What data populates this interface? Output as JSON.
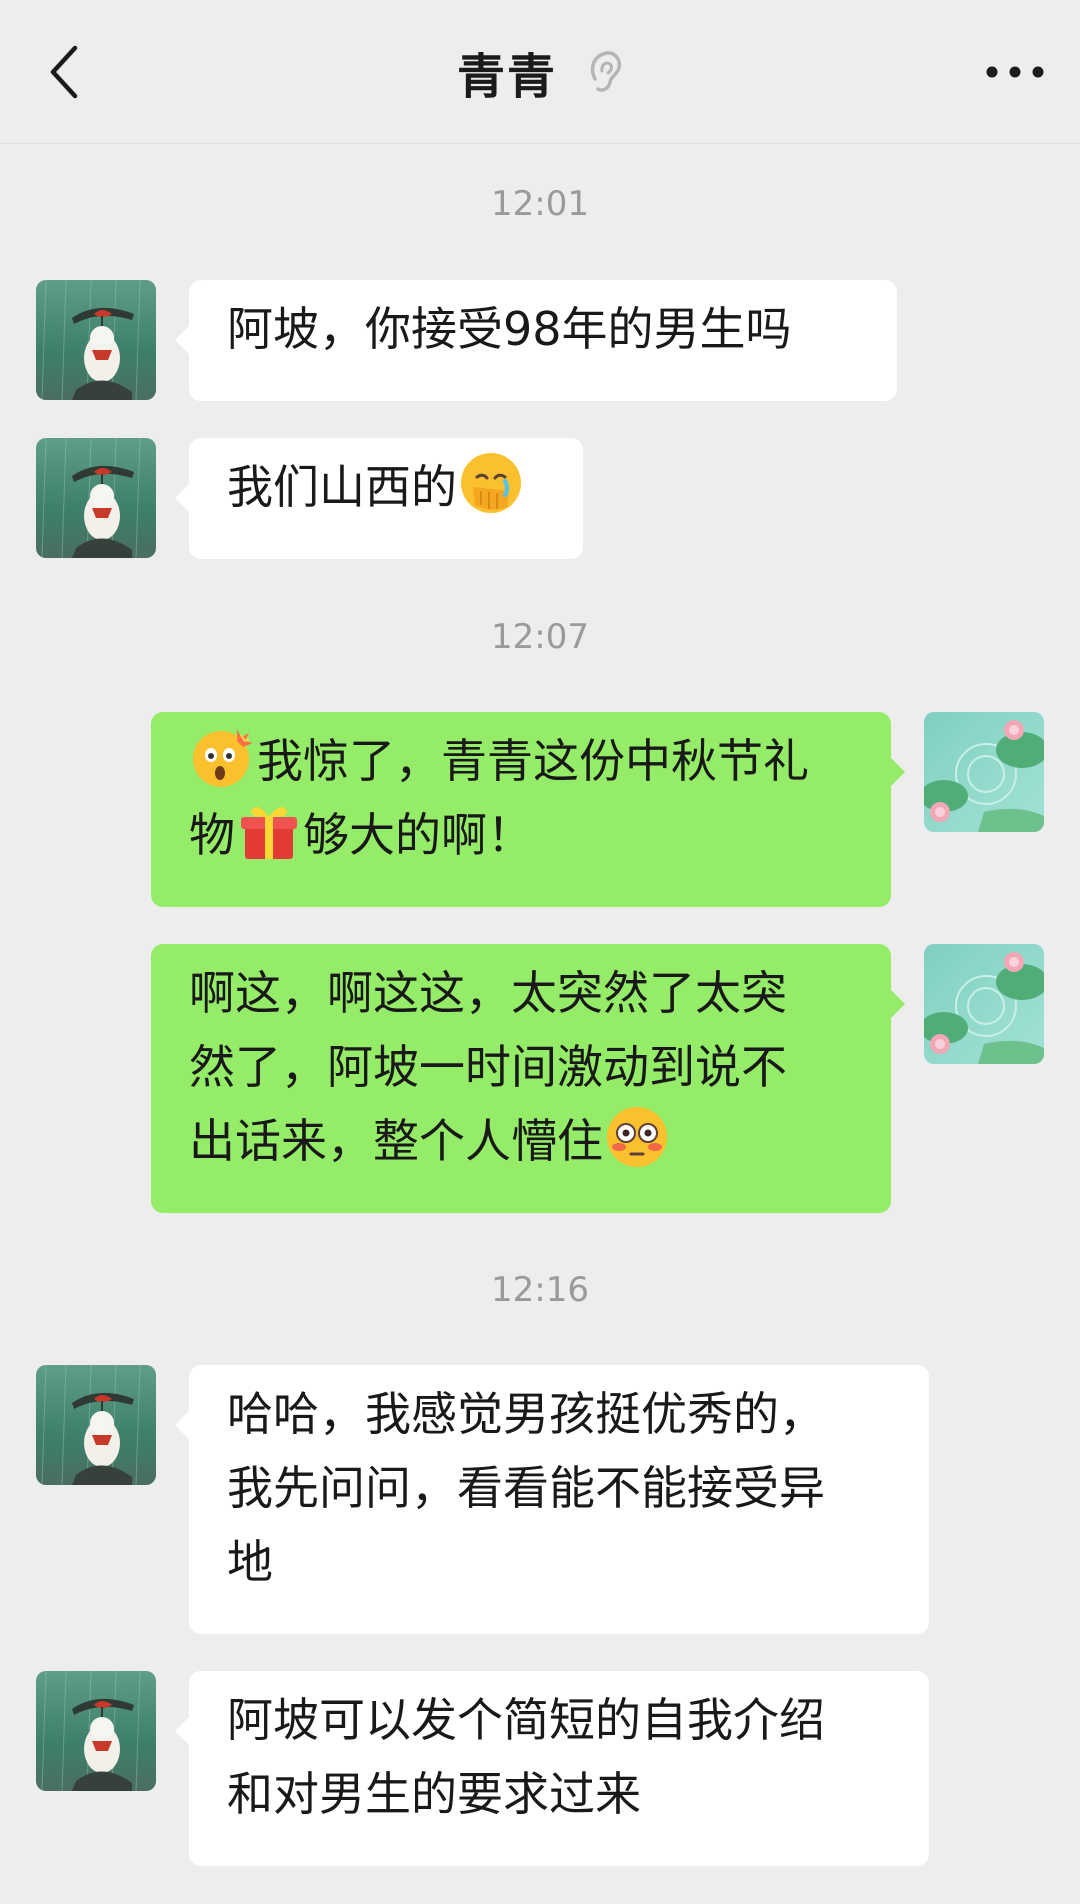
{
  "header": {
    "title": "青青",
    "back_icon": "chevron-left-icon",
    "ear_icon": "ear-icon",
    "more_icon": "more-dots-icon"
  },
  "messages": [
    {
      "type": "time",
      "text": "12:01"
    },
    {
      "type": "msg",
      "side": "left",
      "lines": [
        "阿坡，你接受98年的男生吗"
      ]
    },
    {
      "type": "msg",
      "side": "left",
      "text_before": "我们山西的",
      "emoji": "face-palm-emoji"
    },
    {
      "type": "time",
      "text": "12:07"
    },
    {
      "type": "msg",
      "side": "right",
      "emoji": "exploding-head-emoji",
      "line1": "我惊了，青青这份中秋节礼",
      "line2_a": "物",
      "emoji2": "gift-emoji",
      "line2_b": "够大的啊！"
    },
    {
      "type": "msg",
      "side": "right",
      "lines": [
        "啊这，啊这这，太突然了太突",
        "然了，阿坡一时间激动到说不"
      ],
      "last_line": "出话来，整个人懵住",
      "emoji": "flushed-face-emoji"
    },
    {
      "type": "time",
      "text": "12:16"
    },
    {
      "type": "msg",
      "side": "left",
      "lines": [
        "哈哈，我感觉男孩挺优秀的，",
        "我先问问，看看能不能接受异",
        "地"
      ]
    },
    {
      "type": "msg",
      "side": "left",
      "lines": [
        "阿坡可以发个简短的自我介绍",
        "和对男生的要求过来"
      ]
    }
  ],
  "colors": {
    "background": "#ededed",
    "bubble_self": "#95ec69",
    "bubble_other": "#ffffff",
    "timestamp": "#9a9a9a"
  }
}
